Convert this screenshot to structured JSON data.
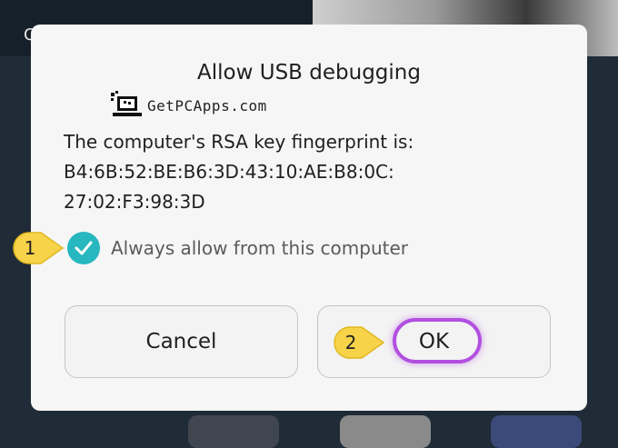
{
  "background": {
    "status_letter": "C"
  },
  "dialog": {
    "title": "Allow USB debugging",
    "watermark": "GetPCApps.com",
    "rsa_label": "The computer's RSA key fingerprint is:",
    "fingerprint_line1": "B4:6B:52:BE:B6:3D:43:10:AE:B8:0C:",
    "fingerprint_line2": "27:02:F3:98:3D",
    "always_allow": {
      "label": "Always allow from this computer",
      "checked": true
    },
    "cancel_label": "Cancel",
    "ok_label": "OK"
  },
  "annotations": [
    {
      "number": "1",
      "target": "always-allow-checkbox"
    },
    {
      "number": "2",
      "target": "ok-button"
    }
  ],
  "colors": {
    "accent_teal": "#26b7bf",
    "highlight_purple": "#b24fe0",
    "badge_yellow": "#f7d34a"
  }
}
